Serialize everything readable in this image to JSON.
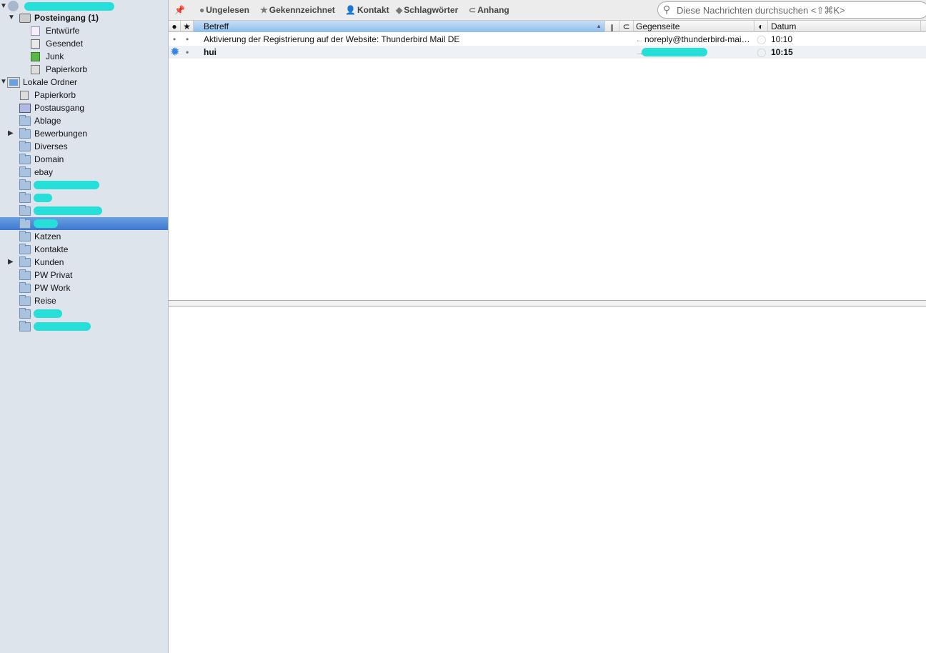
{
  "sidebar": {
    "account": {
      "label_redacted": true
    },
    "inbox": "Posteingang (1)",
    "inbox_children": [
      "Entwürfe",
      "Gesendet",
      "Junk",
      "Papierkorb"
    ],
    "local": "Lokale Ordner",
    "local_children": [
      "Papierkorb",
      "Postausgang",
      "Ablage",
      "Bewerbungen",
      "Diverses",
      "Domain",
      "ebay",
      "",
      "",
      "",
      "",
      "Katzen",
      "Kontakte",
      "Kunden",
      "PW Privat",
      "PW Work",
      "Reise",
      "",
      ""
    ]
  },
  "toolbar": {
    "unread": "Ungelesen",
    "starred": "Gekennzeichnet",
    "contact": "Kontakt",
    "tags": "Schlagwörter",
    "attachment": "Anhang",
    "search_placeholder": "Diese Nachrichten durchsuchen <⇧⌘K>"
  },
  "columns": {
    "subject": "Betreff",
    "correspondent": "Gegenseite",
    "date": "Datum"
  },
  "messages": [
    {
      "subject": "Aktivierung der Registrierung auf der Website: Thunderbird Mail DE",
      "correspondent": "noreply@thunderbird-mai…",
      "date": "10:10",
      "unread": false
    },
    {
      "subject": "hui",
      "correspondent": "",
      "date": "10:15",
      "unread": true
    }
  ],
  "colors": {
    "redaction": "#26dfd8",
    "selection": "#3e78d0"
  }
}
